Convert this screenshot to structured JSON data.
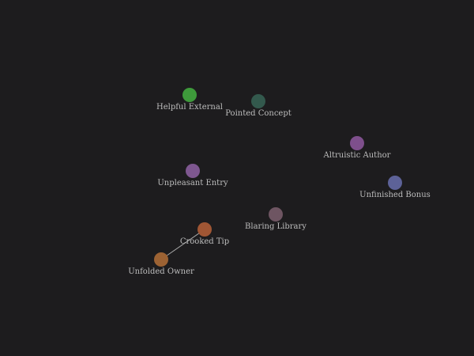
{
  "graph": {
    "nodes": [
      {
        "id": "helpful-external",
        "label": "Helpful External",
        "color": "#3e9a3b"
      },
      {
        "id": "pointed-concept",
        "label": "Pointed Concept",
        "color": "#33594d"
      },
      {
        "id": "altruistic-author",
        "label": "Altruistic Author",
        "color": "#7e4f8c"
      },
      {
        "id": "unpleasant-entry",
        "label": "Unpleasant Entry",
        "color": "#7e5790"
      },
      {
        "id": "unfinished-bonus",
        "label": "Unfinished Bonus",
        "color": "#5d6298"
      },
      {
        "id": "blaring-library",
        "label": "Blaring Library",
        "color": "#6e5562"
      },
      {
        "id": "crooked-tip",
        "label": "Crooked Tip",
        "color": "#a05634"
      },
      {
        "id": "unfolded-owner",
        "label": "Unfolded Owner",
        "color": "#9c6233"
      }
    ],
    "edges": [
      {
        "source": "crooked-tip",
        "target": "unfolded-owner"
      }
    ]
  }
}
